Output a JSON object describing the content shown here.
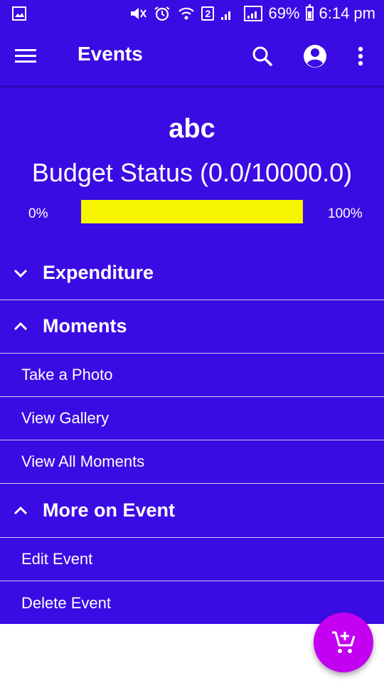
{
  "status_bar": {
    "battery_percent": "69%",
    "time": "6:14 pm",
    "sim_badge": "2"
  },
  "appbar": {
    "title": "Events"
  },
  "event": {
    "name": "abc",
    "budget_status": "Budget Status (0.0/10000.0)",
    "progress_min_label": "0%",
    "progress_max_label": "100%",
    "progress_fraction": 1.0
  },
  "sections": {
    "expenditure": "Expenditure",
    "moments": "Moments",
    "take_photo": "Take a Photo",
    "view_gallery": "View Gallery",
    "view_all_moments": "View All Moments",
    "more_on_event": "More on Event",
    "edit_event": "Edit Event",
    "delete_event": "Delete Event"
  },
  "colors": {
    "primary": "#3a0ce3",
    "progress": "#f5f500",
    "fab": "#c400f0",
    "divider": "#cfc8f5"
  },
  "icons": {
    "menu": "menu-icon",
    "search": "search-icon",
    "account": "account-circle-icon",
    "more": "more-vert-icon",
    "fab": "add-shopping-cart-icon"
  }
}
